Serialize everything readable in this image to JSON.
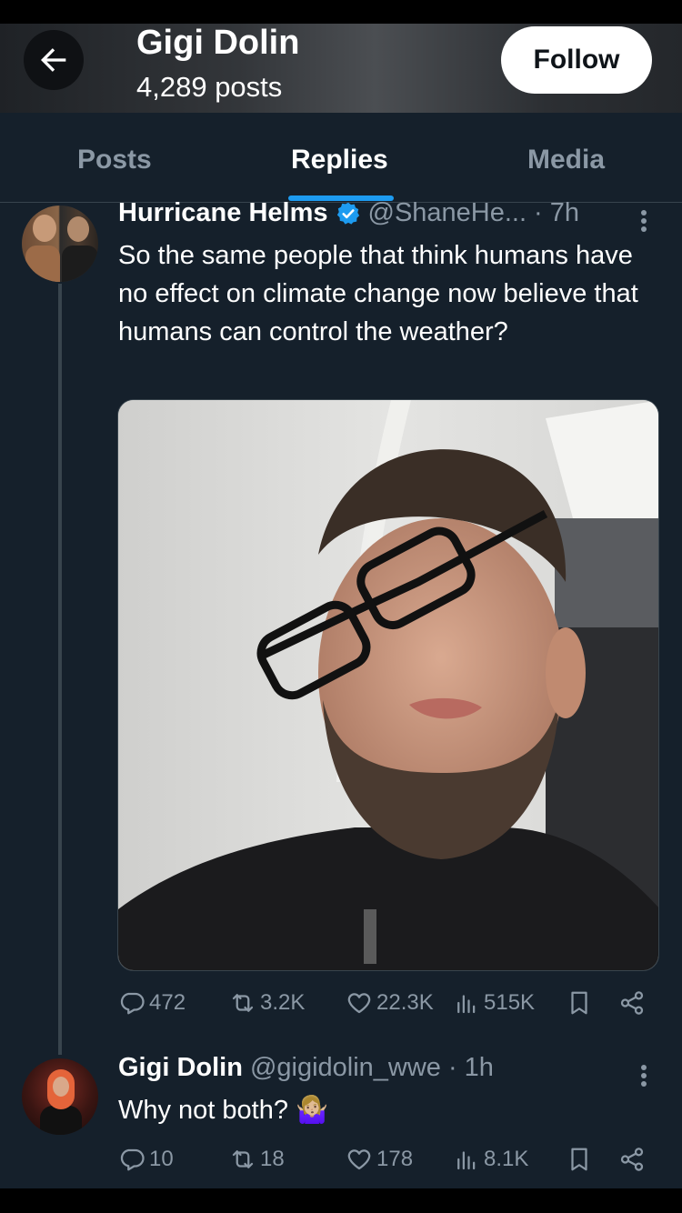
{
  "header": {
    "name": "Gigi Dolin",
    "posts": "4,289 posts",
    "follow_label": "Follow"
  },
  "tabs": [
    {
      "label": "Posts",
      "active": false
    },
    {
      "label": "Replies",
      "active": true
    },
    {
      "label": "Media",
      "active": false
    }
  ],
  "tweets": [
    {
      "name": "Hurricane Helms",
      "verified": true,
      "handle": "@ShaneHe...",
      "time": "· 7h",
      "text": "So the same people that think humans have no effect on climate change now believe that humans can control the weather?",
      "has_media": true,
      "stats": {
        "replies": "472",
        "reposts": "3.2K",
        "likes": "22.3K",
        "views": "515K"
      }
    },
    {
      "name": "Gigi Dolin",
      "verified": false,
      "handle": "@gigidolin_wwe",
      "time": "· 1h",
      "text": "Why not both? 🤷🏼‍♀️",
      "has_media": false,
      "stats": {
        "replies": "10",
        "reposts": "18",
        "likes": "178",
        "views": "8.1K"
      }
    }
  ],
  "colors": {
    "background": "#15202b",
    "accent": "#1d9bf0",
    "muted_text": "#8b98a5"
  }
}
